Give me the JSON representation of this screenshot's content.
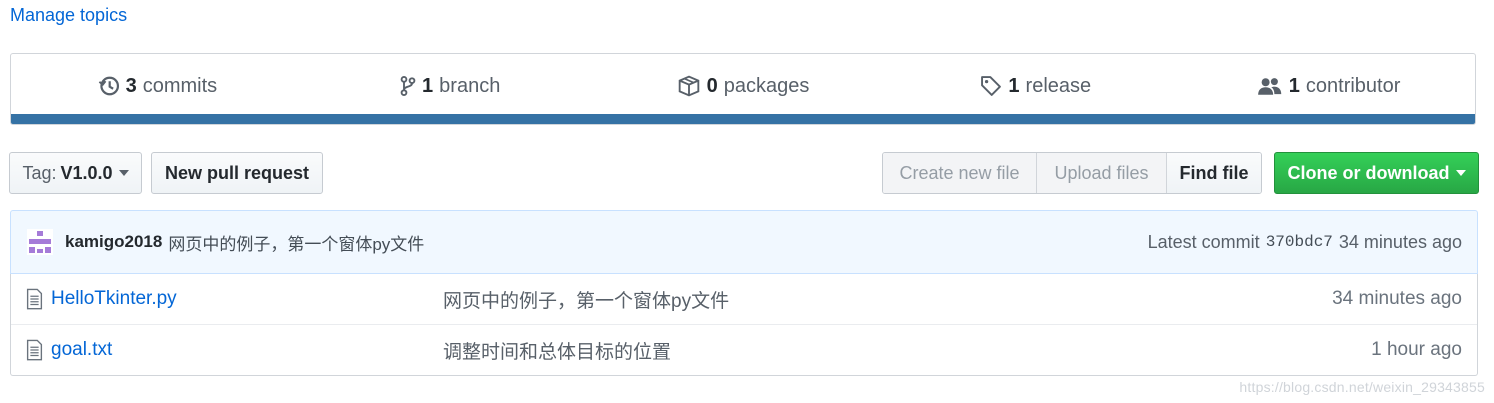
{
  "topics": {
    "manage_label": "Manage topics"
  },
  "summary": {
    "items": [
      {
        "count": "3",
        "label": "commits",
        "icon": "history-icon"
      },
      {
        "count": "1",
        "label": "branch",
        "icon": "git-branch-icon"
      },
      {
        "count": "0",
        "label": "packages",
        "icon": "package-icon"
      },
      {
        "count": "1",
        "label": "release",
        "icon": "tag-icon"
      },
      {
        "count": "1",
        "label": "contributor",
        "icon": "people-icon"
      }
    ],
    "language_bar_color": "#3572A5"
  },
  "toolbar": {
    "tag_prefix": "Tag:",
    "tag_value": "V1.0.0",
    "new_pull_request": "New pull request",
    "create_new_file": "Create new file",
    "upload_files": "Upload files",
    "find_file": "Find file",
    "clone_or_download": "Clone or download"
  },
  "latest_commit": {
    "author": "kamigo2018",
    "message": "网页中的例子，第一个窗体py文件",
    "prefix": "Latest commit",
    "sha": "370bdc7",
    "age": "34 minutes ago"
  },
  "files": [
    {
      "name": "HelloTkinter.py",
      "message": "网页中的例子，第一个窗体py文件",
      "age": "34 minutes ago",
      "icon": "file-text-icon"
    },
    {
      "name": "goal.txt",
      "message": "调整时间和总体目标的位置",
      "age": "1 hour ago",
      "icon": "file-text-icon"
    }
  ],
  "watermark": "https://blog.csdn.net/weixin_29343855",
  "colors": {
    "link": "#0366d6",
    "clone_button": "#28a745",
    "commit_bar_bg": "#f1f8ff"
  }
}
